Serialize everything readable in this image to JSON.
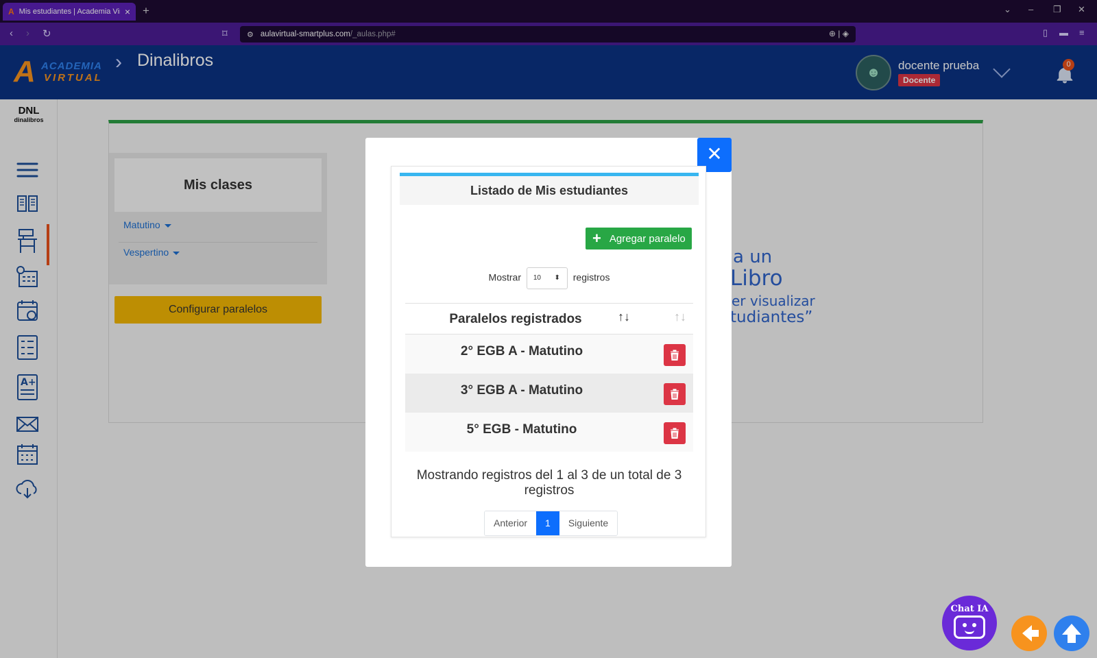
{
  "browser": {
    "tab_title": "Mis estudiantes | Academia Virtual",
    "url_main": "aulavirtual-smartplus.com",
    "url_path": "/_aulas.php#"
  },
  "header": {
    "logo_top": "ACADEMIA",
    "logo_bottom": "VIRTUAL",
    "page_title": "Dinalibros",
    "user_name": "docente prueba",
    "user_role": "Docente",
    "notifications_count": "0"
  },
  "sidebar": {
    "brand_top": "DNL",
    "brand_bottom": "dinalibros",
    "items": [
      "menu-icon",
      "book-icon",
      "classroom-desk-icon",
      "schedule-icon",
      "calendar-people-icon",
      "checklist-icon",
      "grade-icon",
      "mail-icon",
      "calendar-icon",
      "cloud-download-icon"
    ],
    "active_index": 2
  },
  "clases": {
    "title": "Mis clases",
    "items": [
      "Matutino",
      "Vespertino"
    ],
    "config_button": "Configurar paralelos"
  },
  "background_hint": {
    "line1": "a un",
    "line2": "Libro",
    "line3": "er visualizar",
    "line4": "tudiantes”"
  },
  "modal": {
    "title": "Listado de Mis estudiantes",
    "add_button": "Agregar paralelo",
    "show_prefix": "Mostrar",
    "show_value": "10",
    "show_suffix": "registros",
    "column_header": "Paralelos registrados",
    "rows": [
      "2° EGB A - Matutino",
      "3° EGB A - Matutino",
      "5° EGB - Matutino"
    ],
    "info": "Mostrando registros del 1 al 3 de un total de 3 registros",
    "pager": {
      "prev": "Anterior",
      "current": "1",
      "next": "Siguiente"
    }
  },
  "floating": {
    "chat_label": "Chat IA"
  },
  "colors": {
    "header_bg": "#0b3383",
    "accent_green": "#28a745",
    "accent_blue": "#0d6efd",
    "danger": "#dc3545",
    "warning": "#f2b705"
  }
}
